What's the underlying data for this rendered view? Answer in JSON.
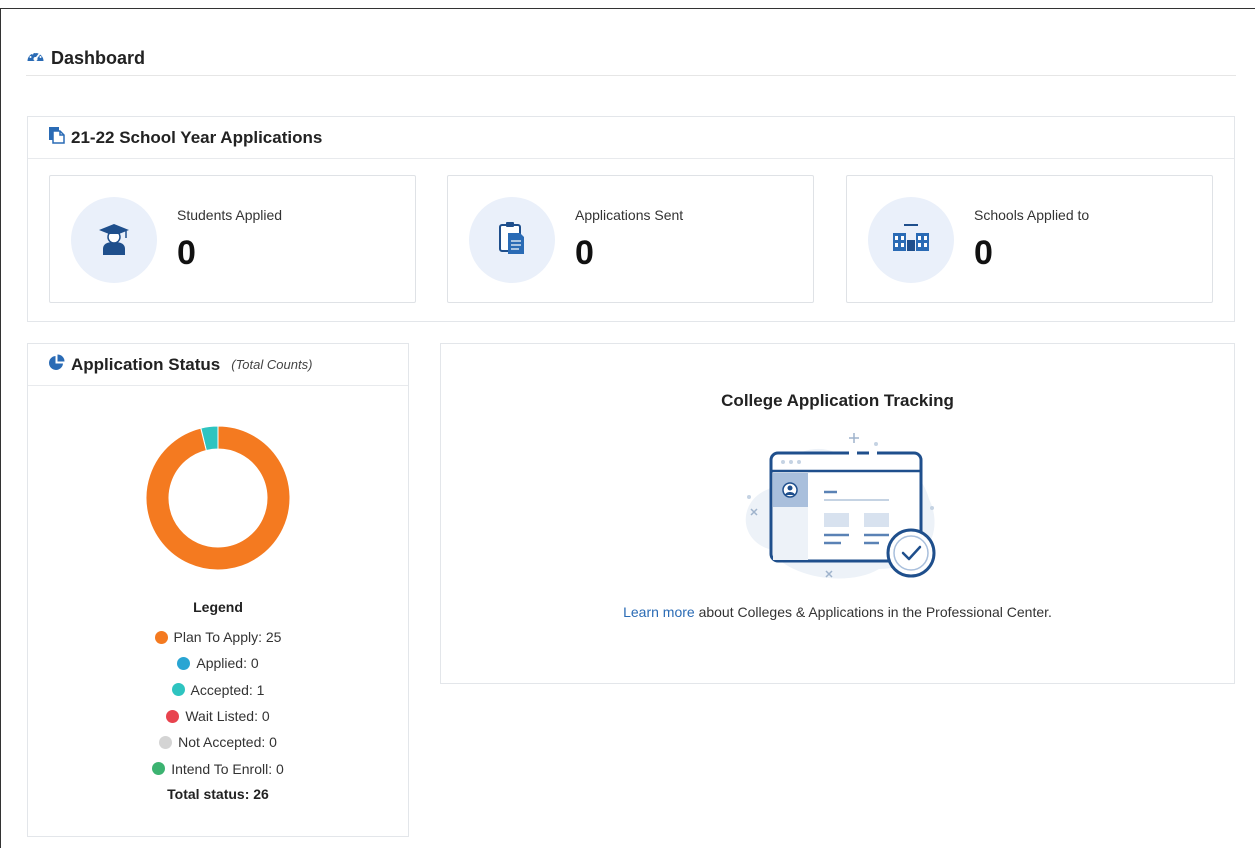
{
  "header": {
    "title": "Dashboard",
    "icon": "gauge-icon"
  },
  "applications_panel": {
    "title": "21-22 School Year Applications",
    "icon": "documents-icon",
    "stats": [
      {
        "label": "Students Applied",
        "value": "0",
        "icon": "graduate-icon"
      },
      {
        "label": "Applications Sent",
        "value": "0",
        "icon": "clipboard-icon"
      },
      {
        "label": "Schools Applied to",
        "value": "0",
        "icon": "school-building-icon"
      }
    ]
  },
  "status_panel": {
    "title": "Application Status",
    "subtitle": "(Total Counts)",
    "icon": "pie-chart-icon",
    "legend_title": "Legend",
    "legend": [
      {
        "label": "Plan To Apply: 25",
        "color": "#f47a20"
      },
      {
        "label": "Applied: 0",
        "color": "#29a5d3"
      },
      {
        "label": "Accepted: 1",
        "color": "#2ec4c0"
      },
      {
        "label": "Wait Listed: 0",
        "color": "#e8434e"
      },
      {
        "label": "Not Accepted: 0",
        "color": "#d4d4d4"
      },
      {
        "label": "Intend To Enroll: 0",
        "color": "#3cb371"
      }
    ],
    "total": "Total status: 26"
  },
  "chart_data": {
    "type": "pie",
    "donut": true,
    "categories": [
      "Plan To Apply",
      "Applied",
      "Accepted",
      "Wait Listed",
      "Not Accepted",
      "Intend To Enroll"
    ],
    "values": [
      25,
      0,
      1,
      0,
      0,
      0
    ],
    "colors": [
      "#f47a20",
      "#29a5d3",
      "#2ec4c0",
      "#e8434e",
      "#d4d4d4",
      "#3cb371"
    ]
  },
  "promo": {
    "title": "College Application Tracking",
    "link_text": "Learn more",
    "text_after": " about Colleges & Applications in the Professional Center."
  }
}
